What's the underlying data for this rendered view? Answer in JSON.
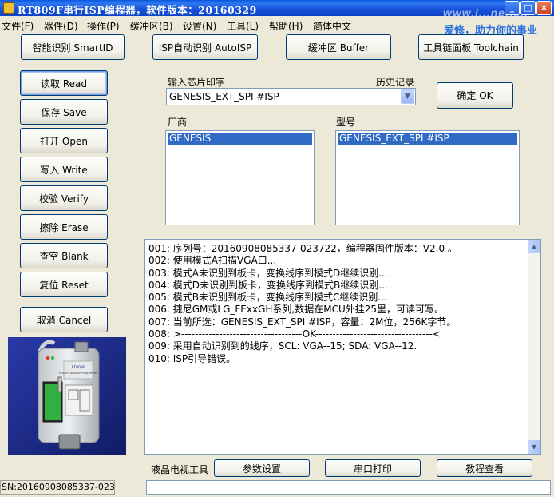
{
  "window": {
    "title": "RT809F串行ISP编程器，软件版本：20160329",
    "watermark": "www.i...net.cn",
    "slogan": "爱修，助力你的事业",
    "controls": {
      "minimize": "_",
      "maximize": "□",
      "close": "×"
    }
  },
  "menu": [
    {
      "label": "文件(F)"
    },
    {
      "label": "器件(D)"
    },
    {
      "label": "操作(P)"
    },
    {
      "label": "缓冲区(B)"
    },
    {
      "label": "设置(N)"
    },
    {
      "label": "工具(L)"
    },
    {
      "label": "帮助(H)"
    },
    {
      "label": "简体中文"
    }
  ],
  "top_buttons": {
    "smartid": "智能识别 SmartID",
    "autoisp": "ISP自动识别 AutoISP",
    "buffer": "缓冲区 Buffer",
    "toolchain": "工具链面板 Toolchain"
  },
  "side_buttons": {
    "read": "读取 Read",
    "save": "保存 Save",
    "open": "打开 Open",
    "write": "写入 Write",
    "verify": "校验 Verify",
    "erase": "擦除 Erase",
    "blank": "查空 Blank",
    "reset": "复位 Reset",
    "cancel": "取消 Cancel"
  },
  "chip_input": {
    "label": "输入芯片印字",
    "history_label": "历史记录",
    "value": "GENESIS_EXT_SPI #ISP",
    "confirm": "确定 OK"
  },
  "vendor": {
    "label": "厂商",
    "selected": "GENESIS"
  },
  "model": {
    "label": "型号",
    "selected": "GENESIS_EXT_SPI #ISP"
  },
  "log": [
    "001: 序列号：20160908085337-023722，编程器固件版本：V2.0 。",
    "002: 使用模式A扫描VGA口...",
    "003: 模式A未识别到板卡，变换线序到模式D继续识别...",
    "004: 模式D未识别到板卡，变换线序到模式B继续识别...",
    "005: 模式B未识别到板卡，变换线序到模式C继续识别...",
    "006: 捷尼GM或LG_FExxGH系列,数据在MCU外挂25里，可读可写。",
    "007: 当前所选：GENESIS_EXT_SPI #ISP，容量：2M位，256K字节。",
    "008: >-----------------------------------OK----------------------------------<",
    "009: 采用自动识别到的线序，SCL: VGA--15; SDA: VGA--12.",
    "010: ISP引导错误。"
  ],
  "bottom": {
    "lcd_tools_label": "液晶电视工具",
    "params": "参数设置",
    "serial_print": "串口打印",
    "tutorial": "教程查看"
  },
  "device_photo": {
    "caption": "RT809F Serial ISP Programmer",
    "brand": "RT809F"
  },
  "status": {
    "sn": "SN:20160908085337-023722"
  }
}
